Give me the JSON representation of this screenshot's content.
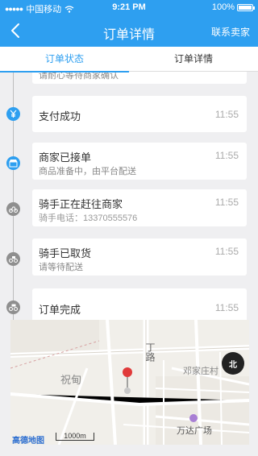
{
  "status_bar": {
    "carrier": "中国移动",
    "time": "9:21 PM",
    "battery": "100%"
  },
  "nav": {
    "title": "订单详情",
    "contact_label": "联系卖家"
  },
  "tabs": [
    {
      "label": "订单状态",
      "active": true
    },
    {
      "label": "订单详情",
      "active": false
    }
  ],
  "timeline": {
    "partial_text": "请耐心等待商家确认",
    "steps": [
      {
        "name": "支付成功",
        "sub": "",
        "time": "11:55",
        "icon": "yuan-icon"
      },
      {
        "name": "商家已接单",
        "sub": "商品准备中，由平台配送",
        "time": "11:55",
        "icon": "store-icon"
      },
      {
        "name": "骑手正在赶往商家",
        "sub": "骑手电话：13370555576",
        "time": "11:55",
        "icon": "scooter-icon"
      },
      {
        "name": "骑手已取货",
        "sub": "请等待配送",
        "time": "11:55",
        "icon": "scooter-package-icon"
      },
      {
        "name": "订单完成",
        "sub": "",
        "time": "11:55",
        "icon": "scooter-done-icon"
      }
    ]
  },
  "map": {
    "labels": {
      "road": "丁路",
      "village": "邓家庄村",
      "district": "祝甸",
      "plaza": "万达广场",
      "logo": "高德地图",
      "scale": "1000m",
      "compass": "北"
    }
  }
}
